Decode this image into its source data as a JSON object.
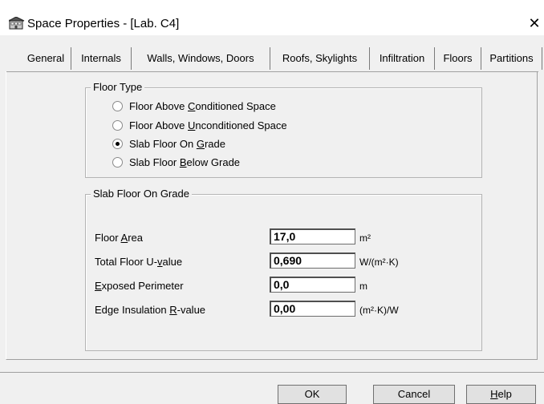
{
  "window": {
    "title": "Space Properties - [Lab. C4]",
    "close_glyph": "✕"
  },
  "tabs": [
    {
      "label": "General",
      "active": false
    },
    {
      "label": "Internals",
      "active": false
    },
    {
      "label": "Walls, Windows, Doors",
      "active": false
    },
    {
      "label": "Roofs, Skylights",
      "active": false
    },
    {
      "label": "Infiltration",
      "active": false
    },
    {
      "label": "Floors",
      "active": true
    },
    {
      "label": "Partitions",
      "active": false
    }
  ],
  "floor_type": {
    "legend": "Floor Type",
    "options": [
      {
        "pre": "Floor Above ",
        "mnemonic": "C",
        "post": "onditioned Space",
        "selected": false
      },
      {
        "pre": "Floor Above ",
        "mnemonic": "U",
        "post": "nconditioned Space",
        "selected": false
      },
      {
        "pre": "Slab Floor On ",
        "mnemonic": "G",
        "post": "rade",
        "selected": true
      },
      {
        "pre": "Slab Floor ",
        "mnemonic": "B",
        "post": "elow Grade",
        "selected": false
      }
    ]
  },
  "slab": {
    "legend": "Slab Floor On Grade",
    "fields": [
      {
        "pre": "Floor ",
        "mnemonic": "A",
        "post": "rea",
        "value": "17,0",
        "unit": "m²"
      },
      {
        "pre": "Total Floor U-",
        "mnemonic": "v",
        "post": "alue",
        "value": "0,690",
        "unit": "W/(m²·K)"
      },
      {
        "pre": "",
        "mnemonic": "E",
        "post": "xposed Perimeter",
        "value": "0,0",
        "unit": "m"
      },
      {
        "pre": "Edge Insulation ",
        "mnemonic": "R",
        "post": "-value",
        "value": "0,00",
        "unit": "(m²·K)/W"
      }
    ]
  },
  "buttons": {
    "ok": "OK",
    "cancel": "Cancel",
    "help_mnemonic": "H",
    "help_rest": "elp"
  },
  "colors": {
    "dialog_bg": "#f0f0f0",
    "titlebar_bg": "#ffffff"
  },
  "icons": {
    "app": "building-icon",
    "close": "close-icon"
  }
}
